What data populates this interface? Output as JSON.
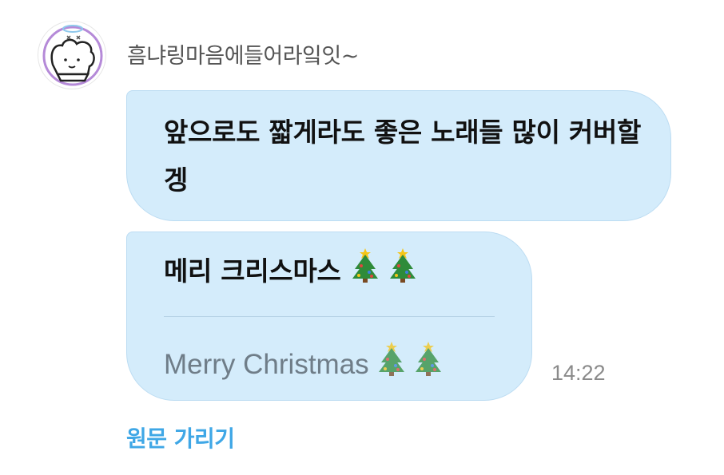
{
  "sender": {
    "name": "흠냐링마음에들어라잌잇~"
  },
  "messages": [
    {
      "text": "앞으로도 짧게라도 좋은 노래들 많이 커버할겡"
    },
    {
      "text": "메리 크리스마스",
      "translation": "Merry Christmas",
      "emoji": "christmas-tree-icon",
      "emoji_count": 2
    }
  ],
  "timestamp": "14:22",
  "translate_toggle_label": "원문 가리기",
  "colors": {
    "bubble": "#d4ecfb",
    "link": "#3fa7e6",
    "timestamp": "#8a8a8a",
    "translation": "#6f7d88"
  }
}
